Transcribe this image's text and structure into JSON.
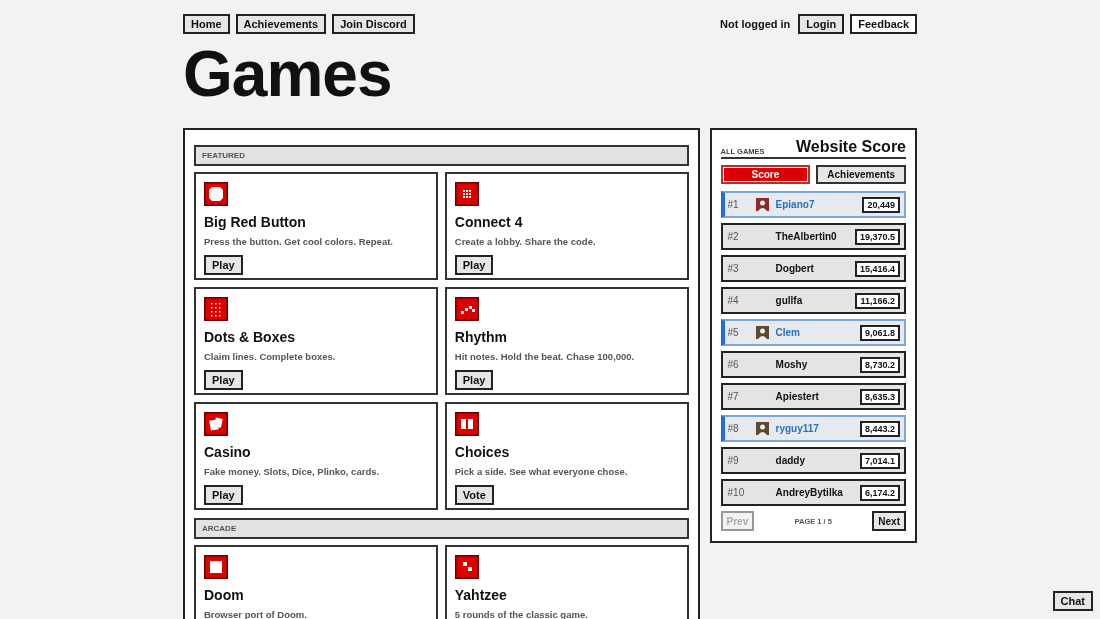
{
  "nav": {
    "links": [
      "Home",
      "Achievements",
      "Join Discord"
    ],
    "status": "Not logged in",
    "actions": [
      {
        "label": "Login",
        "selected": false
      },
      {
        "label": "Feedback",
        "selected": true
      }
    ]
  },
  "title": "Games",
  "sections": [
    {
      "heading": "FEATURED",
      "games": [
        {
          "name": "Big Red Button",
          "description": "Press the button. Get cool colors. Repeat.",
          "action": "Play"
        },
        {
          "name": "Connect 4",
          "description": "Create a lobby. Share the code.",
          "action": "Play"
        },
        {
          "name": "Dots & Boxes",
          "description": "Claim lines. Complete boxes.",
          "action": "Play"
        },
        {
          "name": "Rhythm",
          "description": "Hit notes. Hold the beat. Chase 100,000.",
          "action": "Play"
        },
        {
          "name": "Casino",
          "description": "Fake money. Slots, Dice, Plinko, cards.",
          "action": "Play"
        },
        {
          "name": "Choices",
          "description": "Pick a side. See what everyone chose.",
          "action": "Vote"
        }
      ]
    },
    {
      "heading": "ARCADE",
      "games": [
        {
          "name": "Doom",
          "description": "Browser port of Doom."
        },
        {
          "name": "Yahtzee",
          "description": "5 rounds of the classic game."
        }
      ]
    }
  ],
  "leaderboard": {
    "scope": "ALL GAMES",
    "title": "Website Score",
    "tabs": [
      {
        "label": "Score",
        "selected": true
      },
      {
        "label": "Achievements",
        "selected": false
      }
    ],
    "rows": [
      {
        "rank": "#1",
        "name": "Epiano7",
        "score": "20,449",
        "highlighted": true,
        "avatar": true
      },
      {
        "rank": "#2",
        "name": "TheAlbertin0",
        "score": "19,370.5",
        "highlighted": false,
        "avatar": false
      },
      {
        "rank": "#3",
        "name": "Dogbert",
        "score": "15,416.4",
        "highlighted": false,
        "avatar": false
      },
      {
        "rank": "#4",
        "name": "gullfa",
        "score": "11,166.2",
        "highlighted": false,
        "avatar": false
      },
      {
        "rank": "#5",
        "name": "Clem",
        "score": "9,061.8",
        "highlighted": true,
        "avatar": true
      },
      {
        "rank": "#6",
        "name": "Moshy",
        "score": "8,730.2",
        "highlighted": false,
        "avatar": false
      },
      {
        "rank": "#7",
        "name": "Apiestert",
        "score": "8,635.3",
        "highlighted": false,
        "avatar": false
      },
      {
        "rank": "#8",
        "name": "ryguy117",
        "score": "8,443.2",
        "highlighted": true,
        "avatar": true
      },
      {
        "rank": "#9",
        "name": "daddy",
        "score": "7,014.1",
        "highlighted": false,
        "avatar": false
      },
      {
        "rank": "#10",
        "name": "AndreyBytilka",
        "score": "6,174.2",
        "highlighted": false,
        "avatar": false
      }
    ],
    "pager": {
      "prev": {
        "label": "Prev",
        "disabled": true
      },
      "page": "PAGE 1 / 5",
      "next": {
        "label": "Next",
        "disabled": false
      }
    }
  },
  "chat": "Chat"
}
